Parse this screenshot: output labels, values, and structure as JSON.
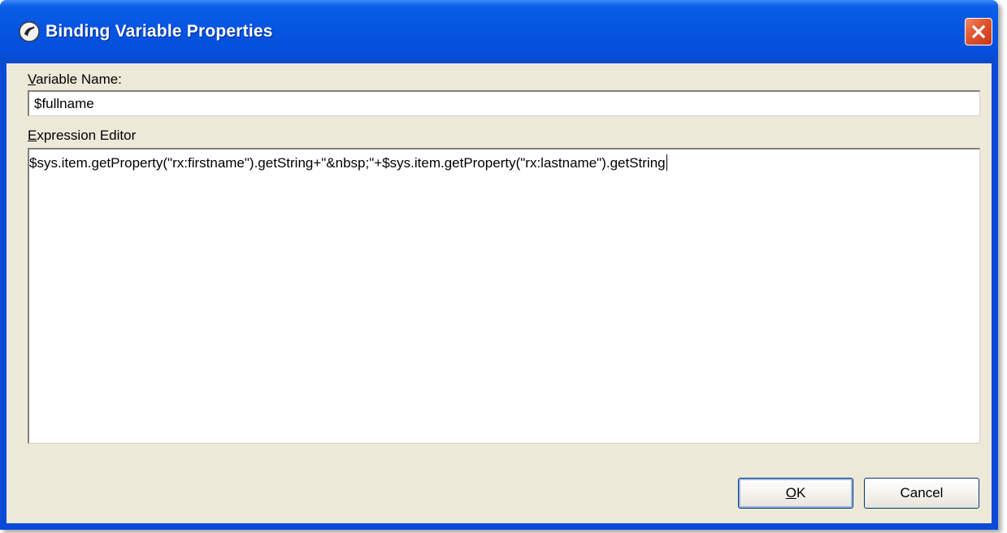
{
  "window": {
    "title": "Binding Variable Properties",
    "app_icon": "app-logo-icon",
    "close_icon": "close-icon"
  },
  "form": {
    "variable_name_label_accel": "V",
    "variable_name_label_rest": "ariable Name:",
    "variable_name_value": "$fullname",
    "expression_label_accel": "E",
    "expression_label_rest": "xpression Editor",
    "expression_value": "$sys.item.getProperty(\"rx:firstname\").getString+\"&nbsp;\"+$sys.item.getProperty(\"rx:lastname\").getString"
  },
  "buttons": {
    "ok_accel": "O",
    "ok_rest": "K",
    "cancel_label": "Cancel"
  },
  "colors": {
    "titlebar": "#0655e0",
    "client_bg": "#ece9d8",
    "close_button": "#e05a32"
  }
}
